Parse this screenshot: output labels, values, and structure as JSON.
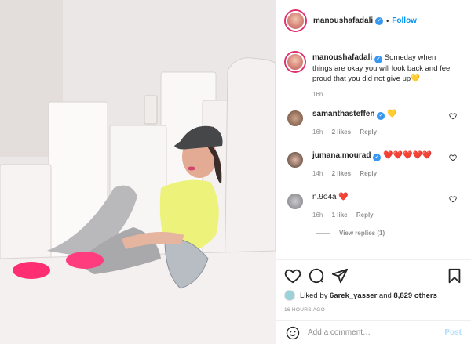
{
  "post": {
    "author": "manoushafadali",
    "follow_label": "Follow",
    "separator": "•"
  },
  "caption": {
    "username": "manoushafadali",
    "text": "Someday when things are okay you will look back and feel proud that you did not give up💛",
    "time": "16h"
  },
  "comments": [
    {
      "username": "samanthasteffen",
      "text": "💛",
      "time": "16h",
      "likes": "2 likes",
      "reply": "Reply"
    },
    {
      "username": "jumana.mourad",
      "text": "❤️❤️❤️❤️❤️",
      "time": "14h",
      "likes": "2 likes",
      "reply": "Reply"
    },
    {
      "username": "n.9o4a",
      "text": "❤️",
      "time": "16h",
      "likes": "1 like",
      "reply": "Reply"
    }
  ],
  "view_replies": "View replies (1)",
  "liked_by": {
    "prefix": "Liked by",
    "user": "6arek_yasser",
    "and": "and",
    "count": "8,829 others"
  },
  "posted_ago": "16 HOURS AGO",
  "add_comment": {
    "placeholder": "Add a comment…",
    "post_label": "Post"
  },
  "icons": {
    "like": "heart-icon",
    "comment": "comment-bubble-icon",
    "share": "paper-plane-icon",
    "save": "bookmark-icon",
    "emoji": "smiley-icon"
  },
  "colors": {
    "accent": "#0095f6",
    "verified": "#3897f0",
    "heart": "#ed1c24"
  }
}
